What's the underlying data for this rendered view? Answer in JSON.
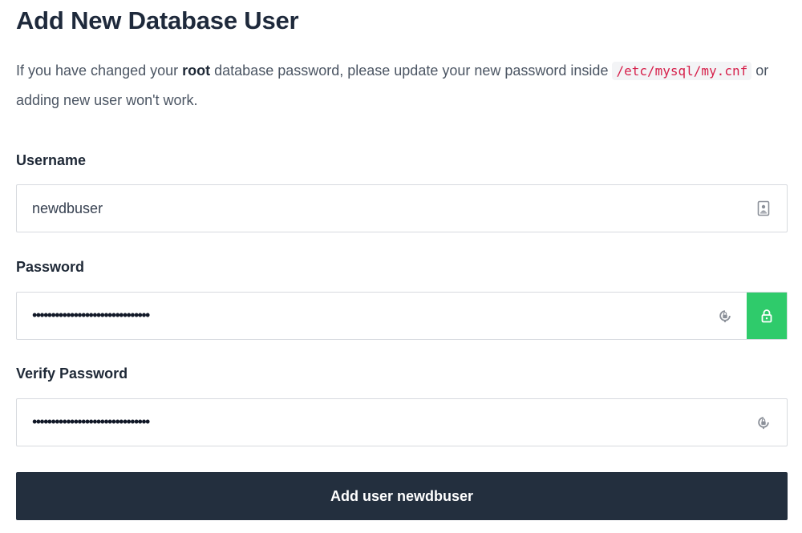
{
  "page": {
    "title": "Add New Database User"
  },
  "intro": {
    "before_root": "If you have changed your ",
    "root": "root",
    "after_root": " database password, please update your new password inside ",
    "path": "/etc/mysql/my.cnf",
    "after_path": " or adding new user won't work."
  },
  "form": {
    "username": {
      "label": "Username",
      "value": "newdbuser",
      "icon": "contact-card-icon"
    },
    "password": {
      "label": "Password",
      "masked_value": "•••••••••••••••••••••••••••••••",
      "manager_icon": "password-manager-icon",
      "generate_icon": "lock-icon",
      "generate_color": "#2fcb6b"
    },
    "verify_password": {
      "label": "Verify Password",
      "masked_value": "•••••••••••••••••••••••••••••••",
      "manager_icon": "password-manager-icon"
    },
    "submit_label": "Add user newdbuser",
    "submit_color": "#232f3e"
  }
}
